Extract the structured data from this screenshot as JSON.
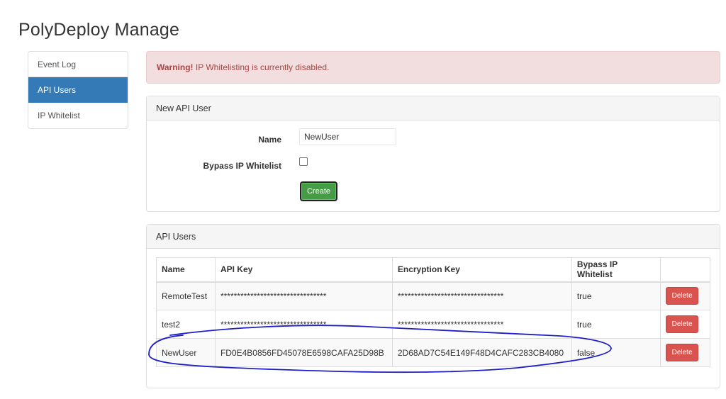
{
  "app": {
    "title": "PolyDeploy Manage"
  },
  "sidebar": {
    "items": [
      {
        "label": "Event Log"
      },
      {
        "label": "API Users"
      },
      {
        "label": "IP Whitelist"
      }
    ]
  },
  "alert": {
    "strong": "Warning!",
    "message": " IP Whitelisting is currently disabled."
  },
  "new_user_panel": {
    "title": "New API User",
    "name_label": "Name",
    "name_value": "NewUser",
    "bypass_label": "Bypass IP Whitelist",
    "create_label": "Create"
  },
  "users_panel": {
    "title": "API Users",
    "columns": [
      "Name",
      "API Key",
      "Encryption Key",
      "Bypass IP Whitelist",
      ""
    ],
    "rows": [
      {
        "name": "RemoteTest",
        "api_key": "********************************",
        "enc_key": "********************************",
        "bypass": "true",
        "delete": "Delete"
      },
      {
        "name": "test2",
        "api_key": "********************************",
        "enc_key": "********************************",
        "bypass": "true",
        "delete": "Delete"
      },
      {
        "name": "NewUser",
        "api_key": "FD0E4B0856FD45078E6598CAFA25D98B",
        "enc_key": "2D68AD7C54E149F48D4CAFC283CB4080",
        "bypass": "false",
        "delete": "Delete"
      }
    ]
  },
  "colors": {
    "active_nav": "#337ab7",
    "alert_bg": "#f2dede",
    "alert_text": "#a94442",
    "create_button": "#449d44",
    "delete_button": "#d9534f",
    "annotation_stroke": "#1f1fc8"
  }
}
